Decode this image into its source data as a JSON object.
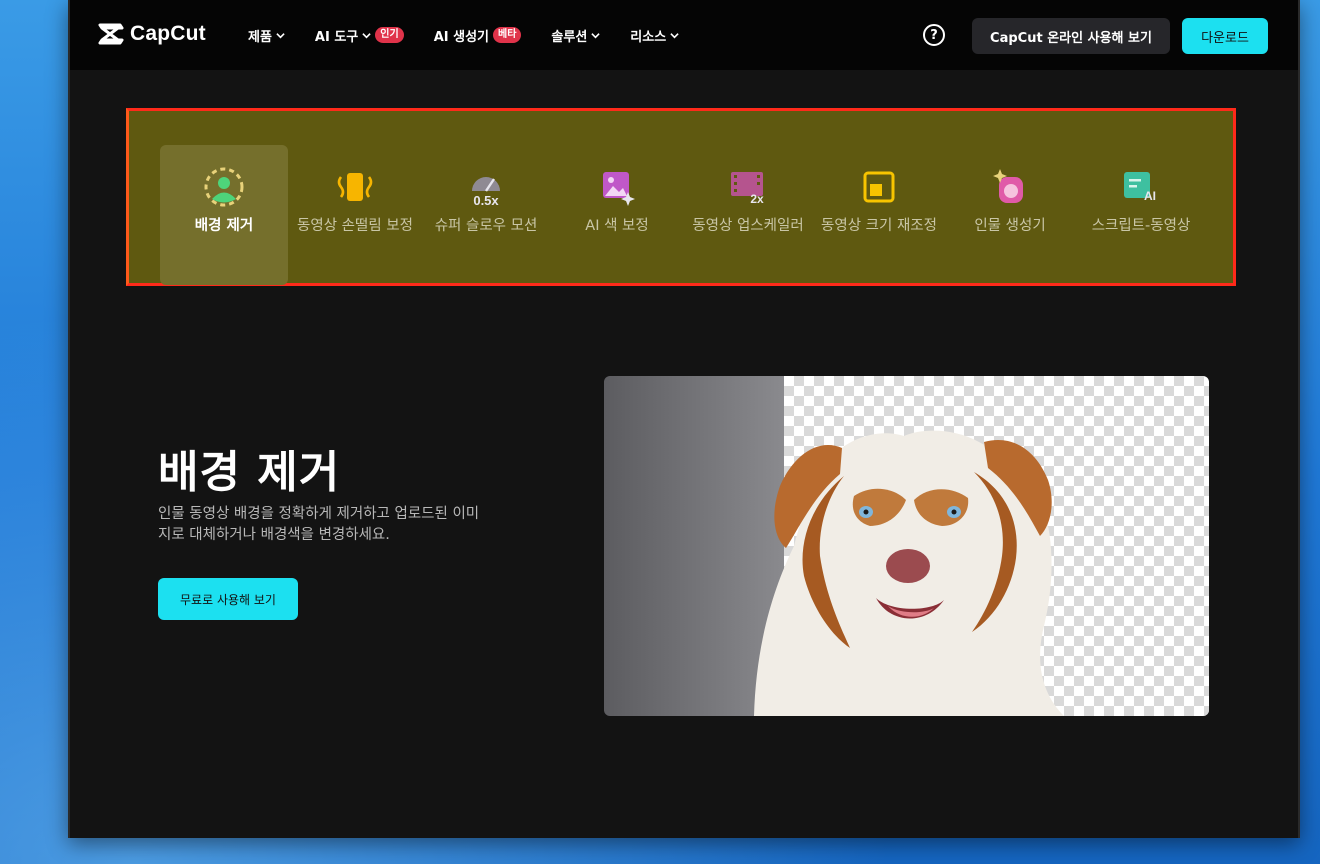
{
  "header": {
    "logo_text": "CapCut",
    "nav": [
      {
        "label": "제품",
        "has_chevron": true,
        "badge": ""
      },
      {
        "label": "AI 도구",
        "has_chevron": true,
        "badge": "인기"
      },
      {
        "label": "AI 생성기",
        "has_chevron": false,
        "badge": "베타"
      },
      {
        "label": "솔루션",
        "has_chevron": true,
        "badge": ""
      },
      {
        "label": "리소스",
        "has_chevron": true,
        "badge": ""
      }
    ],
    "help_icon": "?",
    "online_button": "CapCut 온라인 사용해 보기",
    "download_button": "다운로드"
  },
  "tools": [
    {
      "label": "배경 제거",
      "icon": "person-cutout-icon",
      "active": true
    },
    {
      "label": "동영상 손떨림 보정",
      "icon": "stabilize-icon",
      "active": false
    },
    {
      "label": "슈퍼 슬로우 모션",
      "icon": "slow-motion-icon",
      "active": false
    },
    {
      "label": "AI 색 보정",
      "icon": "image-sparkle-icon",
      "active": false
    },
    {
      "label": "동영상 업스케일러",
      "icon": "film-2x-icon",
      "active": false
    },
    {
      "label": "동영상 크기 재조정",
      "icon": "resize-icon",
      "active": false
    },
    {
      "label": "인물 생성기",
      "icon": "portrait-sparkle-icon",
      "active": false
    },
    {
      "label": "스크립트-동영상",
      "icon": "script-ai-icon",
      "active": false
    }
  ],
  "hero": {
    "title": "배경 제거",
    "description": "인물 동영상 배경을 정확하게 제거하고 업로드된 이미지로 대체하거나 배경색을 변경하세요.",
    "cta": "무료로 사용해 보기"
  },
  "icon_text": {
    "slow": "0.5x",
    "upscale": "2x",
    "ai": "AI"
  },
  "colors": {
    "accent": "#1ce0f0",
    "badge": "#e0334a",
    "highlight": "#5f5910",
    "highlight_border": "#ff2a1a"
  }
}
